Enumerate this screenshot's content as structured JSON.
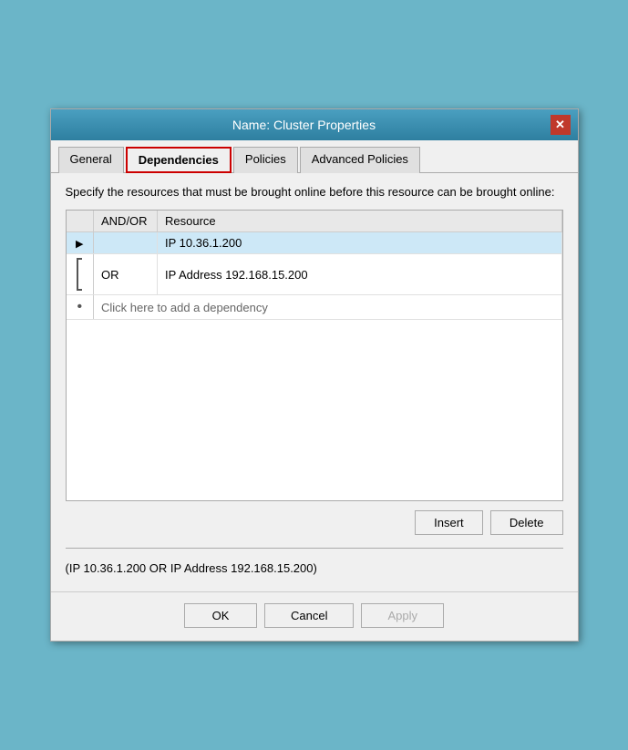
{
  "dialog": {
    "title": "Name: Cluster Properties",
    "close_label": "✕"
  },
  "tabs": [
    {
      "id": "general",
      "label": "General",
      "active": false
    },
    {
      "id": "dependencies",
      "label": "Dependencies",
      "active": true
    },
    {
      "id": "policies",
      "label": "Policies",
      "active": false
    },
    {
      "id": "advanced-policies",
      "label": "Advanced Policies",
      "active": false
    }
  ],
  "content": {
    "description": "Specify the resources that must be brought online before this resource can be brought online:",
    "table": {
      "headers": [
        "",
        "AND/OR",
        "Resource"
      ],
      "rows": [
        {
          "selector": "▶",
          "andor": "",
          "resource": "IP 10.36.1.200",
          "selected": true
        },
        {
          "selector": "",
          "andor": "OR",
          "resource": "IP Address 192.168.15.200",
          "selected": false
        }
      ],
      "add_row_text": "Click here to add a dependency"
    },
    "insert_button": "Insert",
    "delete_button": "Delete",
    "formula": "(IP 10.36.1.200  OR  IP Address 192.168.15.200)"
  },
  "footer": {
    "ok_label": "OK",
    "cancel_label": "Cancel",
    "apply_label": "Apply"
  }
}
